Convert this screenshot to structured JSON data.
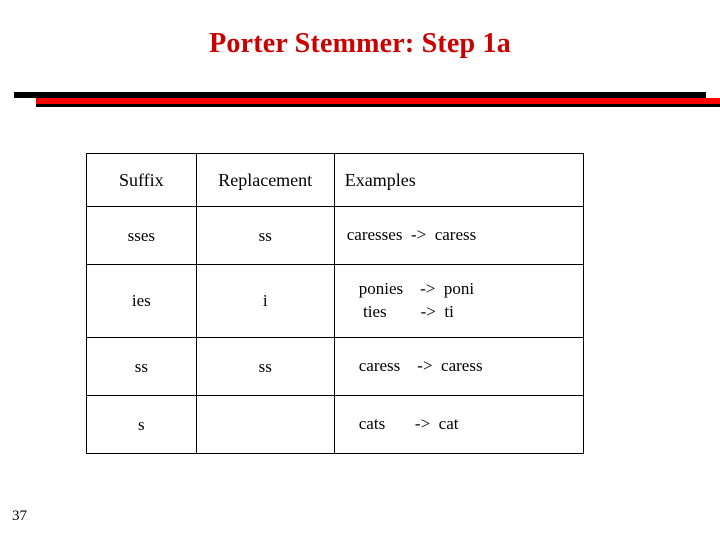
{
  "slide": {
    "title": "Porter Stemmer: Step 1a",
    "page_number": "37",
    "accent_color": "#cc0000",
    "rule_colors": [
      "#000000",
      "#ff0000"
    ]
  },
  "table": {
    "headers": [
      "Suffix",
      "Replacement",
      "Examples"
    ],
    "rows": [
      {
        "suffix": "sses",
        "replacement": "ss",
        "examples": [
          "caresses  ->  caress"
        ]
      },
      {
        "suffix": "ies",
        "replacement": "i",
        "examples": [
          "ponies    ->  poni",
          " ties        ->  ti"
        ]
      },
      {
        "suffix": "ss",
        "replacement": "ss",
        "examples": [
          "caress    ->  caress"
        ]
      },
      {
        "suffix": "s",
        "replacement": "",
        "examples": [
          "cats       ->  cat"
        ]
      }
    ]
  }
}
